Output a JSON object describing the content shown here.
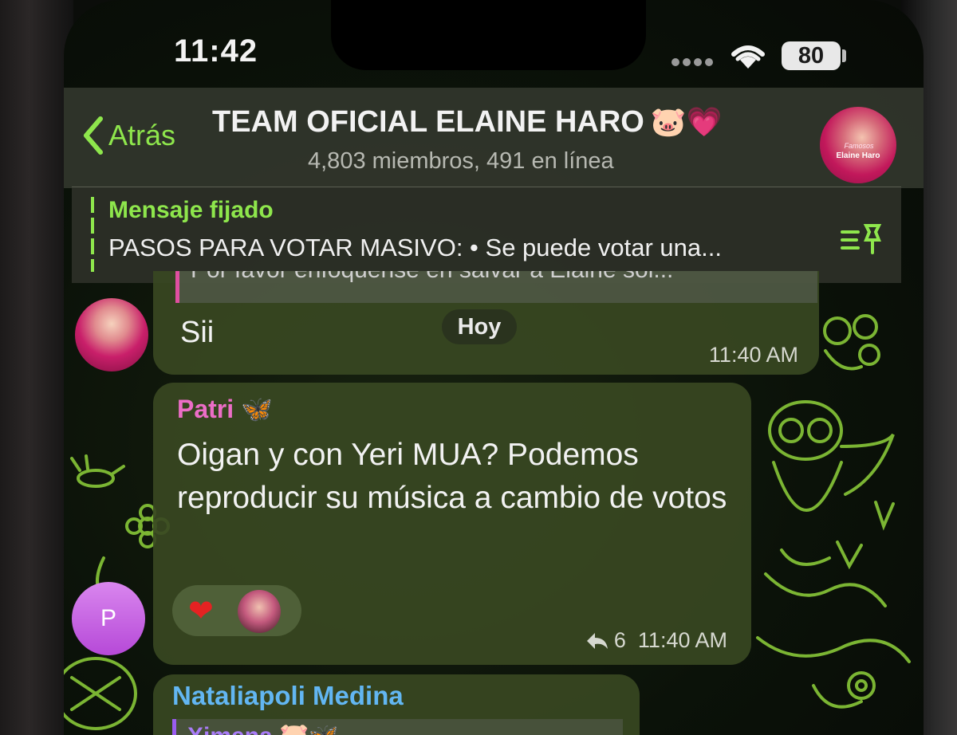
{
  "status_bar": {
    "time": "11:42",
    "battery": "80"
  },
  "header": {
    "back_label": "Atrás",
    "title": "TEAM OFICIAL ELAINE HARO",
    "title_emoji": "🐷💗",
    "subtitle": "4,803 miembros, 491 en línea",
    "avatar_text_top": "Famosos",
    "avatar_text_bottom": "Elaine Haro"
  },
  "pinned": {
    "title": "Mensaje fijado",
    "text": "PASOS PARA VOTAR MASIVO: • Se puede votar una..."
  },
  "messages": [
    {
      "quote": "Por favor enfóquense en salvar a Elaine sol...",
      "text": "Sii",
      "time": "11:40 AM"
    },
    {
      "sender": "Patri 🦋",
      "text": "Oigan y con Yeri MUA? Podemos reproducir su música a cambio de votos",
      "reaction": "❤",
      "replies": "6",
      "time": "11:40 AM",
      "avatar_letter": "P"
    },
    {
      "sender": "Nataliapoli Medina",
      "quote_sender": "Ximena 🐷🦋"
    }
  ],
  "date_separator": "Hoy",
  "colors": {
    "accent": "#8ee64c",
    "sender_patri": "#ec6dc7",
    "sender_natalia": "#62b6f2",
    "bubble": "#384822"
  }
}
